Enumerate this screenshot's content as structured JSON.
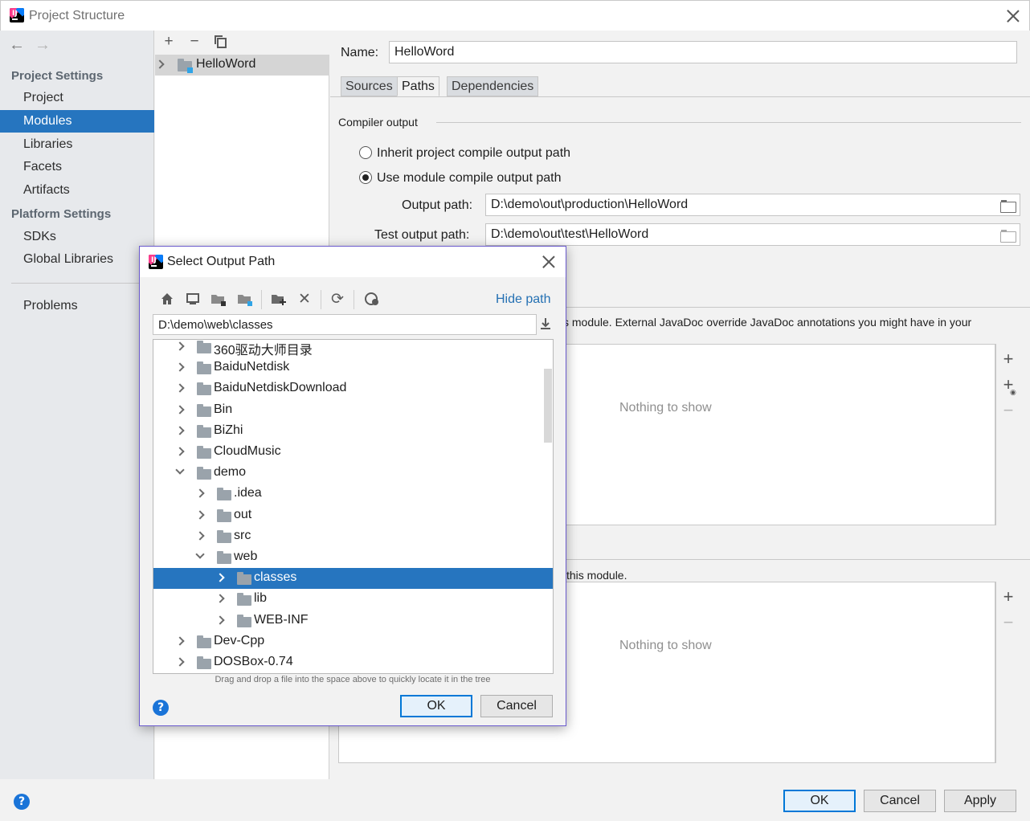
{
  "window": {
    "title": "Project Structure"
  },
  "sidebar": {
    "project_settings_heading": "Project Settings",
    "platform_settings_heading": "Platform Settings",
    "items": [
      {
        "label": "Project"
      },
      {
        "label": "Modules",
        "selected": true
      },
      {
        "label": "Libraries"
      },
      {
        "label": "Facets"
      },
      {
        "label": "Artifacts"
      },
      {
        "label": "SDKs"
      },
      {
        "label": "Global Libraries"
      },
      {
        "label": "Problems"
      }
    ]
  },
  "modules": {
    "items": [
      {
        "label": "HelloWord"
      }
    ]
  },
  "content": {
    "name_label": "Name:",
    "name_value": "HelloWord",
    "tabs": [
      {
        "label": "Sources"
      },
      {
        "label": "Paths",
        "active": true
      },
      {
        "label": "Dependencies"
      }
    ],
    "compiler_output_heading": "Compiler output",
    "inherit_option": "Inherit project compile output path",
    "use_module_option": "Use module compile output path",
    "selected_option": "use_module",
    "output_path_label": "Output path:",
    "output_path_value": "D:\\demo\\out\\production\\HelloWord",
    "test_output_path_label": "Test output path:",
    "test_output_path_value": "D:\\demo\\out\\test\\HelloWord",
    "javadoc_text_fragment": "s module. External JavaDoc override JavaDoc annotations you might have in your",
    "annotations_text_fragment": "this module.",
    "nothing_to_show": "Nothing to show"
  },
  "footer": {
    "ok": "OK",
    "cancel": "Cancel",
    "apply": "Apply"
  },
  "dialog": {
    "title": "Select Output Path",
    "hide_path": "Hide path",
    "path_value": "D:\\demo\\web\\classes",
    "hint": "Drag and drop a file into the space above to quickly locate it in the tree",
    "ok": "OK",
    "cancel": "Cancel",
    "tree": [
      {
        "label": "360驱动大师目录",
        "depth": 0,
        "expanded": false
      },
      {
        "label": "BaiduNetdisk",
        "depth": 0,
        "expanded": false
      },
      {
        "label": "BaiduNetdiskDownload",
        "depth": 0,
        "expanded": false
      },
      {
        "label": "Bin",
        "depth": 0,
        "expanded": false
      },
      {
        "label": "BiZhi",
        "depth": 0,
        "expanded": false
      },
      {
        "label": "CloudMusic",
        "depth": 0,
        "expanded": false
      },
      {
        "label": "demo",
        "depth": 0,
        "expanded": true
      },
      {
        "label": ".idea",
        "depth": 1,
        "expanded": false
      },
      {
        "label": "out",
        "depth": 1,
        "expanded": false
      },
      {
        "label": "src",
        "depth": 1,
        "expanded": false
      },
      {
        "label": "web",
        "depth": 1,
        "expanded": true
      },
      {
        "label": "classes",
        "depth": 2,
        "expanded": false,
        "selected": true
      },
      {
        "label": "lib",
        "depth": 2,
        "expanded": false
      },
      {
        "label": "WEB-INF",
        "depth": 2,
        "expanded": false
      },
      {
        "label": "Dev-Cpp",
        "depth": 0,
        "expanded": false
      },
      {
        "label": "DOSBox-0.74",
        "depth": 0,
        "expanded": false
      }
    ]
  },
  "icons": {
    "back": "arrow-left-icon",
    "forward": "arrow-right-icon",
    "add": "plus-icon",
    "remove": "minus-icon",
    "copy": "copy-icon",
    "home": "home-icon",
    "desktop": "desktop-icon",
    "project": "project-folder-icon",
    "module": "module-folder-icon",
    "new_folder": "new-folder-icon",
    "delete": "delete-icon",
    "refresh": "refresh-icon",
    "hidden": "show-hidden-icon",
    "download": "download-icon",
    "browse": "folder-browse-icon",
    "help": "help-icon",
    "close": "close-icon"
  },
  "colors": {
    "selection": "#2675bf",
    "link": "#2470b3",
    "default_button_border": "#0078d7"
  }
}
